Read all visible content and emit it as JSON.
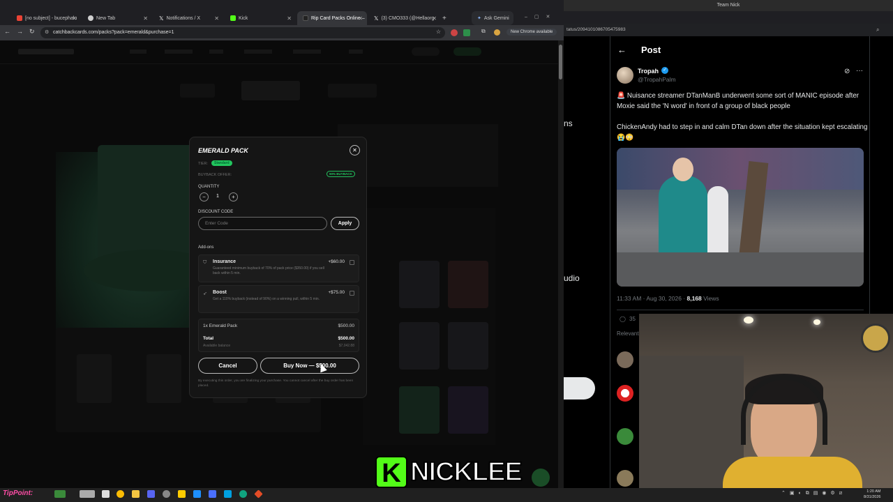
{
  "browser": {
    "tabs": [
      {
        "label": "[no subject] - bucephalu",
        "color": "#ea4335"
      },
      {
        "label": "New Tab",
        "color": "#cfcfcf"
      },
      {
        "label": "Notifications / X",
        "color": "#ffffff"
      },
      {
        "label": "Kick",
        "color": "#53fc18"
      },
      {
        "label": "Rip Card Packs Online –",
        "color": "#222222"
      },
      {
        "label": "(3) CMO333 (@Hellaorg",
        "color": "#ffffff"
      }
    ],
    "ask_gemini": "Ask Gemini",
    "url": "catchbackcards.com/packs?pack=emerald&purchase=1",
    "chrome_available": "New Chrome available"
  },
  "modal": {
    "title": "EMERALD PACK",
    "tier_label": "TIER:",
    "tier_badge": "Standard",
    "buyback_label": "BUYBACK OFFER:",
    "buyback_badge": "90% BUYBACK",
    "quantity_label": "QUANTITY",
    "quantity_value": "1",
    "minus": "−",
    "plus": "+",
    "discount_label": "DISCOUNT CODE",
    "discount_placeholder": "Enter Code",
    "apply": "Apply",
    "addons_label": "Add-ons",
    "addons": [
      {
        "name": "Insurance",
        "price": "+$60.00",
        "desc": "Guaranteed minimum buyback of 70% of pack price ($350.00) if you sell back within 5 min."
      },
      {
        "name": "Boost",
        "price": "+$75.00",
        "desc": "Get a 110% buyback (instead of 90%) on a winning pull, within 5 min."
      }
    ],
    "summary": {
      "line_item": "1x Emerald Pack",
      "line_price": "$500.00",
      "total_label": "Total",
      "total_value": "$500.00",
      "balance_label": "Available balance",
      "balance_value": "$7,042.88"
    },
    "cancel": "Cancel",
    "buy_now": "Buy Now — $500.00",
    "legal": "By executing this order, you are finalizing your purchase. You cannot cancel after the buy order has been placed."
  },
  "x_post": {
    "window_title": "Team Nick",
    "url_fragment": "tatus/2094101086705475983",
    "header": "Post",
    "author": "Tropah",
    "handle": "@TropahPalm",
    "text_line1": "🚨 Nuisance streamer DTanManB underwent some sort of MANIC episode after Moxie said the 'N word' in front of a group of black people",
    "text_line2": "ChickenAndy had to step in and calm DTan down after the situation kept escalating 😭😳",
    "time": "11:33 AM · Aug 30, 2026 · ",
    "views_count": "8,168",
    "views_label": " Views",
    "reply_count": "35",
    "relevant": "Relevant",
    "side_fragment_1": "ns",
    "side_fragment_2": "udio"
  },
  "overlay": {
    "kick_letter": "K",
    "streamer_name": "NICKLEE",
    "logo": "TipPoint:"
  },
  "taskbar": {
    "time": "1:20 AM",
    "date": "8/31/2026"
  }
}
